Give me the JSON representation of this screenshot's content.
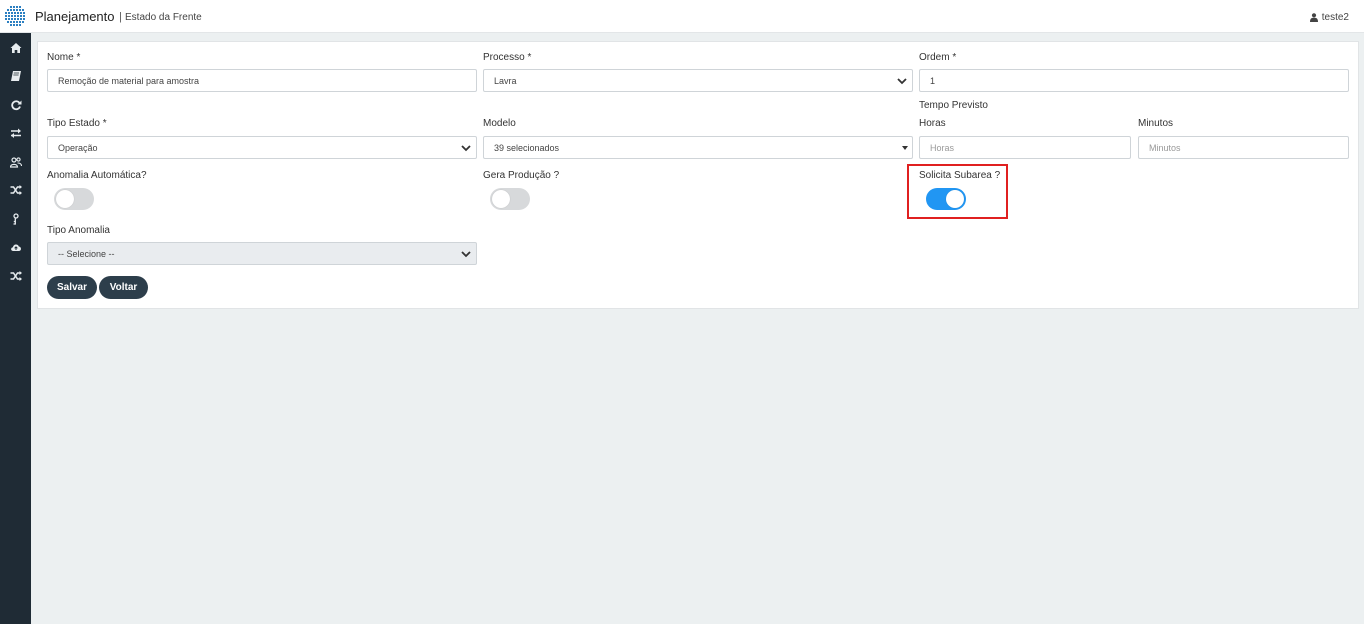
{
  "header": {
    "app_title": "Planejamento",
    "separator": "|",
    "page_subtitle": "Estado da Frente",
    "user_name": "teste2"
  },
  "sidebar": {
    "items": [
      {
        "icon": "home-icon"
      },
      {
        "icon": "book-icon"
      },
      {
        "icon": "refresh-icon"
      },
      {
        "icon": "exchange-icon"
      },
      {
        "icon": "users-icon"
      },
      {
        "icon": "shuffle-icon"
      },
      {
        "icon": "key-icon"
      },
      {
        "icon": "cloud-upload-icon"
      },
      {
        "icon": "shuffle-icon"
      }
    ]
  },
  "form": {
    "nome": {
      "label": "Nome *",
      "value": "Remoção de material para amostra"
    },
    "processo": {
      "label": "Processo *",
      "value": "Lavra"
    },
    "ordem": {
      "label": "Ordem *",
      "value": "1"
    },
    "tempo_previsto_label": "Tempo Previsto",
    "tipo_estado": {
      "label": "Tipo Estado *",
      "value": "Operação"
    },
    "modelo": {
      "label": "Modelo",
      "value": "39 selecionados"
    },
    "horas": {
      "label": "Horas",
      "placeholder": "Horas"
    },
    "minutos": {
      "label": "Minutos",
      "placeholder": "Minutos"
    },
    "anomalia_automatica": {
      "label": "Anomalia Automática?",
      "checked": false
    },
    "gera_producao": {
      "label": "Gera Produção ?",
      "checked": false
    },
    "solicita_subarea": {
      "label": "Solicita Subarea ?",
      "checked": true
    },
    "tipo_anomalia": {
      "label": "Tipo Anomalia",
      "value": "-- Selecione --"
    },
    "save_label": "Salvar",
    "back_label": "Voltar"
  },
  "colors": {
    "sidebar_bg": "#1f2b35",
    "toggle_on": "#2196f3",
    "button_bg": "#2d3e4b",
    "highlight": "#e02020"
  }
}
